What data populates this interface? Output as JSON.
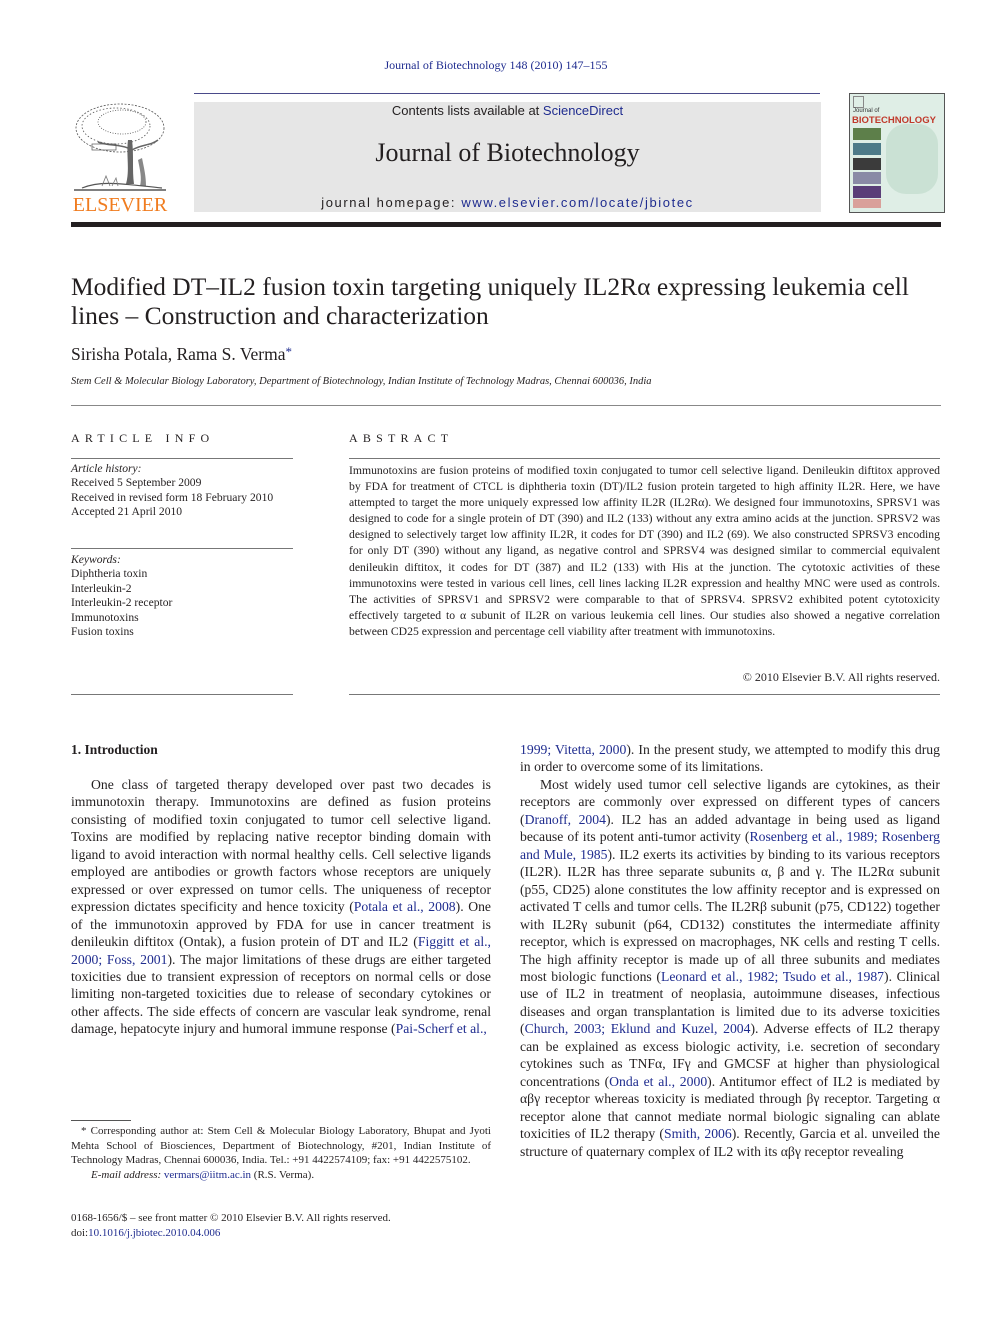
{
  "running_head": "Journal of Biotechnology 148 (2010) 147–155",
  "publisher": {
    "wordmark": "ELSEVIER",
    "logo_icon": "elsevier-tree-icon"
  },
  "masthead": {
    "contents_prefix": "Contents lists available at ",
    "contents_link": "ScienceDirect",
    "journal_title": "Journal of Biotechnology",
    "homepage_prefix": "journal homepage: ",
    "homepage_link": "www.elsevier.com/locate/jbiotec"
  },
  "cover": {
    "line1": "Journal of",
    "line2": "BIOTECHNOLOGY"
  },
  "article": {
    "title_line1": "Modified DT–IL2 fusion toxin targeting uniquely IL2Rα expressing leukemia cell",
    "title_line2": "lines – Construction and characterization",
    "authors": "Sirisha Potala, Rama S. Verma",
    "author_mark": "*",
    "affiliation": "Stem Cell & Molecular Biology Laboratory, Department of Biotechnology, Indian Institute of Technology Madras, Chennai 600036, India"
  },
  "article_info": {
    "label": "ARTICLE INFO",
    "history_head": "Article history:",
    "history": [
      "Received 5 September 2009",
      "Received in revised form 18 February 2010",
      "Accepted 21 April 2010"
    ],
    "keywords_head": "Keywords:",
    "keywords": [
      "Diphtheria toxin",
      "Interleukin-2",
      "Interleukin-2 receptor",
      "Immunotoxins",
      "Fusion toxins"
    ]
  },
  "abstract": {
    "label": "ABSTRACT",
    "text": "Immunotoxins are fusion proteins of modified toxin conjugated to tumor cell selective ligand. Denileukin diftitox approved by FDA for treatment of CTCL is diphtheria toxin (DT)/IL2 fusion protein targeted to high affinity IL2R. Here, we have attempted to target the more uniquely expressed low affinity IL2R (IL2Rα). We designed four immunotoxins, SPRSV1 was designed to code for a single protein of DT (390) and IL2 (133) without any extra amino acids at the junction. SPRSV2 was designed to selectively target low affinity IL2R, it codes for DT (390) and IL2 (69). We also constructed SPRSV3 encoding for only DT (390) without any ligand, as negative control and SPRSV4 was designed similar to commercial equivalent denileukin diftitox, it codes for DT (387) and IL2 (133) with His at the junction. The cytotoxic activities of these immunotoxins were tested in various cell lines, cell lines lacking IL2R expression and healthy MNC were used as controls. The activities of SPRSV1 and SPRSV2 were comparable to that of SPRSV4. SPRSV2 exhibited potent cytotoxicity effectively targeted to α subunit of IL2R on various leukemia cell lines. Our studies also showed a negative correlation between CD25 expression and percentage cell viability after treatment with immunotoxins.",
    "copyright": "© 2010 Elsevier B.V. All rights reserved."
  },
  "intro": {
    "heading": "1.  Introduction",
    "left": [
      {
        "t": "One class of targeted therapy developed over past two decades is immunotoxin therapy. Immunotoxins are defined as fusion proteins consisting of modified toxin conjugated to tumor cell selective ligand. Toxins are modified by replacing native receptor binding domain with ligand to avoid interaction with normal healthy cells. Cell selective ligands employed are antibodies or growth factors whose receptors are uniquely expressed or over expressed on tumor cells. The uniqueness of receptor expression dictates specificity and hence toxicity ("
      },
      {
        "l": "Potala et al., 2008"
      },
      {
        "t": "). One of the immunotoxin approved by FDA for use in cancer treatment is denileukin diftitox (Ontak), a fusion protein of DT and IL2 ("
      },
      {
        "l": "Figgitt et al., 2000; Foss, 2001"
      },
      {
        "t": "). The major limitations of these drugs are either targeted toxicities due to transient expression of receptors on normal cells or dose limiting non-targeted toxicities due to release of secondary cytokines or other affects. The side effects of concern are vascular leak syndrome, renal damage, hepatocyte injury and humoral immune response ("
      },
      {
        "l": "Pai-Scherf et al.,"
      }
    ],
    "right_p1": [
      {
        "l": "1999; Vitetta, 2000"
      },
      {
        "t": "). In the present study, we attempted to modify this drug in order to overcome some of its limitations."
      }
    ],
    "right_p2": [
      {
        "t": "Most widely used tumor cell selective ligands are cytokines, as their receptors are commonly over expressed on different types of cancers ("
      },
      {
        "l": "Dranoff, 2004"
      },
      {
        "t": "). IL2 has an added advantage in being used as ligand because of its potent anti-tumor activity ("
      },
      {
        "l": "Rosenberg et al., 1989; Rosenberg and Mule, 1985"
      },
      {
        "t": "). IL2 exerts its activities by binding to its various receptors (IL2R). IL2R has three separate subunits α, β and γ. The IL2Rα subunit (p55, CD25) alone constitutes the low affinity receptor and is expressed on activated T cells and tumor cells. The IL2Rβ subunit (p75, CD122) together with IL2Rγ subunit (p64, CD132) constitutes the intermediate affinity receptor, which is expressed on macrophages, NK cells and resting T cells. The high affinity receptor is made up of all three subunits and mediates most biologic functions ("
      },
      {
        "l": "Leonard et al., 1982; Tsudo et al., 1987"
      },
      {
        "t": "). Clinical use of IL2 in treatment of neoplasia, autoimmune diseases, infectious diseases and organ transplantation is limited due to its adverse toxicities ("
      },
      {
        "l": "Church, 2003; Eklund and Kuzel, 2004"
      },
      {
        "t": "). Adverse effects of IL2 therapy can be explained as excess biologic activity, i.e. secretion of secondary cytokines such as TNFα, IFγ and GMCSF at higher than physiological concentrations ("
      },
      {
        "l": "Onda et al., 2000"
      },
      {
        "t": "). Antitumor effect of IL2 is mediated by αβγ receptor whereas toxicity is mediated through βγ receptor. Targeting α receptor alone that cannot mediate normal biologic signaling can ablate toxicities of IL2 therapy ("
      },
      {
        "l": "Smith, 2006"
      },
      {
        "t": "). Recently, Garcia et al. unveiled the structure of quaternary complex of IL2 with its αβγ receptor revealing"
      }
    ]
  },
  "footnote": {
    "star": "*",
    "text": " Corresponding author at: Stem Cell & Molecular Biology Laboratory, Bhupat and Jyoti Mehta School of Biosciences, Department of Biotechnology, #201, Indian Institute of Technology Madras, Chennai 600036, India. Tel.: +91 4422574109; fax: +91 4422575102.",
    "email_label": "E-mail address:",
    "email": "vermars@iitm.ac.in",
    "email_suffix": " (R.S. Verma)."
  },
  "front_matter": {
    "issn_line": "0168-1656/$ – see front matter © 2010 Elsevier B.V. All rights reserved.",
    "doi_prefix": "doi:",
    "doi": "10.1016/j.jbiotec.2010.04.006"
  }
}
